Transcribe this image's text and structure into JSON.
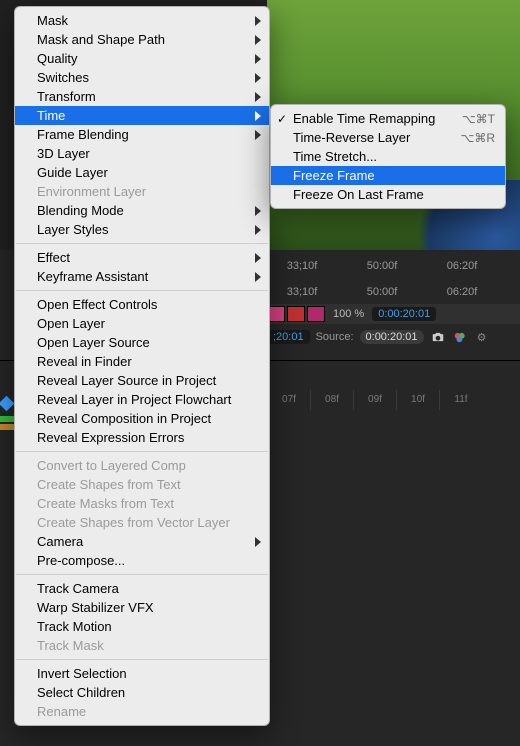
{
  "mainMenu": {
    "items": [
      {
        "label": "Mask",
        "hasSub": true
      },
      {
        "label": "Mask and Shape Path",
        "hasSub": true
      },
      {
        "label": "Quality",
        "hasSub": true
      },
      {
        "label": "Switches",
        "hasSub": true
      },
      {
        "label": "Transform",
        "hasSub": true
      },
      {
        "label": "Time",
        "hasSub": true,
        "highlight": true
      },
      {
        "label": "Frame Blending",
        "hasSub": true
      },
      {
        "label": "3D Layer"
      },
      {
        "label": "Guide Layer"
      },
      {
        "label": "Environment Layer",
        "disabled": true
      },
      {
        "label": "Blending Mode",
        "hasSub": true
      },
      {
        "label": "Layer Styles",
        "hasSub": true
      },
      {
        "sep": true
      },
      {
        "label": "Effect",
        "hasSub": true
      },
      {
        "label": "Keyframe Assistant",
        "hasSub": true
      },
      {
        "sep": true
      },
      {
        "label": "Open Effect Controls"
      },
      {
        "label": "Open Layer"
      },
      {
        "label": "Open Layer Source"
      },
      {
        "label": "Reveal in Finder"
      },
      {
        "label": "Reveal Layer Source in Project"
      },
      {
        "label": "Reveal Layer in Project Flowchart"
      },
      {
        "label": "Reveal Composition in Project"
      },
      {
        "label": "Reveal Expression Errors"
      },
      {
        "sep": true
      },
      {
        "label": "Convert to Layered Comp",
        "disabled": true
      },
      {
        "label": "Create Shapes from Text",
        "disabled": true
      },
      {
        "label": "Create Masks from Text",
        "disabled": true
      },
      {
        "label": "Create Shapes from Vector Layer",
        "disabled": true
      },
      {
        "label": "Camera",
        "hasSub": true
      },
      {
        "label": "Pre-compose..."
      },
      {
        "sep": true
      },
      {
        "label": "Track Camera"
      },
      {
        "label": "Warp Stabilizer VFX"
      },
      {
        "label": "Track Motion"
      },
      {
        "label": "Track Mask",
        "disabled": true
      },
      {
        "sep": true
      },
      {
        "label": "Invert Selection"
      },
      {
        "label": "Select Children"
      },
      {
        "label": "Rename",
        "disabled": true
      }
    ]
  },
  "subMenu": {
    "items": [
      {
        "label": "Enable Time Remapping",
        "checked": true,
        "shortcut": "⌥⌘T"
      },
      {
        "label": "Time-Reverse Layer",
        "shortcut": "⌥⌘R"
      },
      {
        "label": "Time Stretch..."
      },
      {
        "label": "Freeze Frame",
        "highlight": true
      },
      {
        "label": "Freeze On Last Frame"
      }
    ]
  },
  "infoStrip1": {
    "c1": "33;10f",
    "c2": "50:00f",
    "c3": "06:20f"
  },
  "infoStrip2": {
    "c1": "33;10f",
    "c2": "50:00f",
    "c3": "06:20f"
  },
  "toolStrip": {
    "percent": "100 %",
    "timecode": "0:00:20:01"
  },
  "secondary": {
    "timecode": ";20:01",
    "sourceLabel": "Source:",
    "sourceValue": "0:00:20:01"
  },
  "ruler": {
    "ticks": [
      "07f",
      "08f",
      "09f",
      "10f",
      "11f"
    ]
  }
}
